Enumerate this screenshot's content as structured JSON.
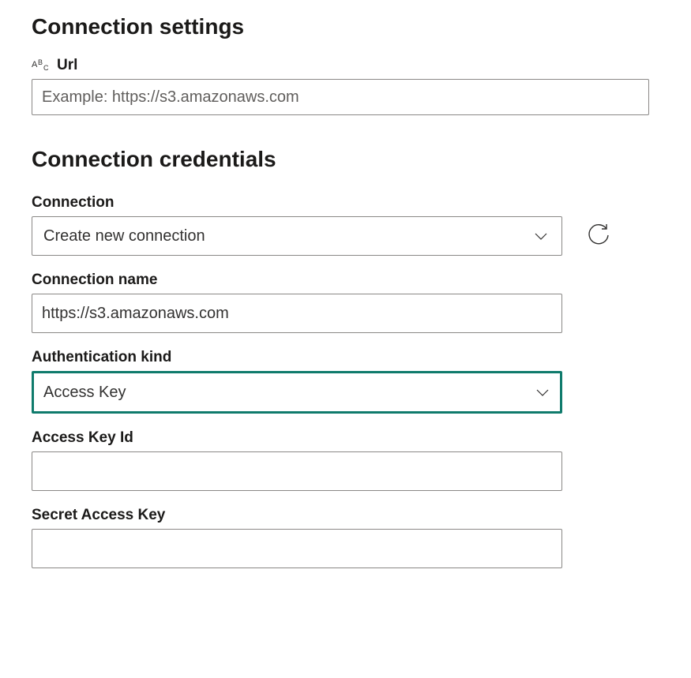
{
  "settings": {
    "heading": "Connection settings",
    "url_label": "Url",
    "url_placeholder": "Example: https://s3.amazonaws.com",
    "url_value": ""
  },
  "credentials": {
    "heading": "Connection credentials",
    "connection_label": "Connection",
    "connection_selected": "Create new connection",
    "connection_name_label": "Connection name",
    "connection_name_value": "https://s3.amazonaws.com",
    "auth_kind_label": "Authentication kind",
    "auth_kind_selected": "Access Key",
    "access_key_id_label": "Access Key Id",
    "access_key_id_value": "",
    "secret_key_label": "Secret Access Key",
    "secret_key_value": ""
  },
  "icons": {
    "abc": "abc-type-icon",
    "chevron": "chevron-down-icon",
    "refresh": "refresh-icon"
  }
}
